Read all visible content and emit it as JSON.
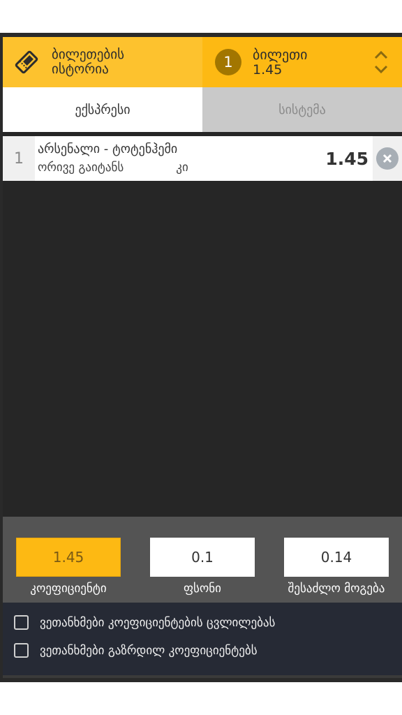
{
  "header": {
    "history_line1": "ბილეთების",
    "history_line2": "ისტორია",
    "slip_count": "1",
    "slip_title": "ბილეთი",
    "slip_odds": "1.45"
  },
  "tabs": [
    {
      "label": "ექსპრესი",
      "active": true
    },
    {
      "label": "სისტემა",
      "active": false
    }
  ],
  "bets": [
    {
      "index": "1",
      "match": "არსენალი - ტოტენჰემი",
      "market": "ორივე გაიტანს",
      "pick": "კი",
      "odd": "1.45"
    }
  ],
  "stake": {
    "odds_value": "1.45",
    "odds_label": "კოეფიციენტი",
    "stake_value": "0.1",
    "stake_label": "ფსონი",
    "win_value": "0.14",
    "win_label": "შესაძლო მოგება"
  },
  "agreements": [
    {
      "label": "ვეთანხმები კოეფიციენტების ცვლილებას",
      "checked": false
    },
    {
      "label": "ვეთანხმები გაზრდილ კოეფიციენტებს",
      "checked": false
    }
  ],
  "colors": {
    "accent": "#fdb913",
    "accent_light": "#fdc22e",
    "dark_bg": "#262626",
    "stake_bg": "#545454"
  }
}
